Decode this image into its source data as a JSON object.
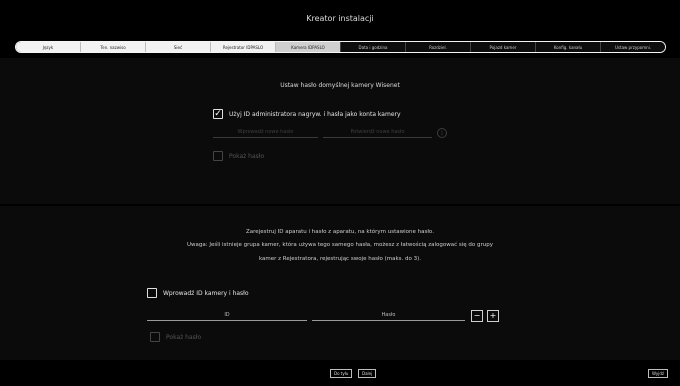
{
  "window": {
    "title": "Kreator instalacji"
  },
  "tabs": [
    {
      "label": "Język",
      "state": "done"
    },
    {
      "label": "Ten. nazwiso",
      "state": "done"
    },
    {
      "label": "Sieć",
      "state": "done"
    },
    {
      "label": "Rejestrator IDPASLO",
      "state": "done"
    },
    {
      "label": "Kamera IDPASLO",
      "state": "current"
    },
    {
      "label": "Data i godzina",
      "state": "pending"
    },
    {
      "label": "Rozdziel.",
      "state": "pending"
    },
    {
      "label": "Pojazd kamer",
      "state": "pending"
    },
    {
      "label": "Konfig. kanału",
      "state": "pending"
    },
    {
      "label": "Ustaw przypomni.",
      "state": "pending"
    }
  ],
  "top": {
    "heading": "Ustaw hasło domyślnej kamery Wisenet",
    "use_admin_checkbox": {
      "label": "Użyj ID administratora nagryw. i hasła jako konta kamery",
      "checked": true
    },
    "password_placeholder": "Wprowadź nowe hasło",
    "confirm_placeholder": "Potwierdź nowe hasło",
    "info_icon": "info-icon",
    "show_password": {
      "label": "Pokaż hasło",
      "checked": false
    }
  },
  "bottom": {
    "line1": "Zarejestruj ID aparatu i hasło z aparatu, na którym ustawione hasło.",
    "line2": "Uwaga: Jeśli istnieje grupa kamer, która używa tego samego hasła, możesz z łatwością zalogować się do grupy",
    "line3": "kamer z Rejestratora, rejestrując swoje hasło (maks. do 3).",
    "enter_id_checkbox": {
      "label": "Wprowadź ID kamery i hasło",
      "checked": false
    },
    "id_label": "ID",
    "password_label": "Hasło",
    "minus_label": "−",
    "plus_label": "+",
    "show_password": {
      "label": "Pokaż hasło",
      "checked": false
    }
  },
  "footer": {
    "back_label": "Do tyłu",
    "next_label": "Dalej",
    "exit_label": "Wyjdź"
  }
}
